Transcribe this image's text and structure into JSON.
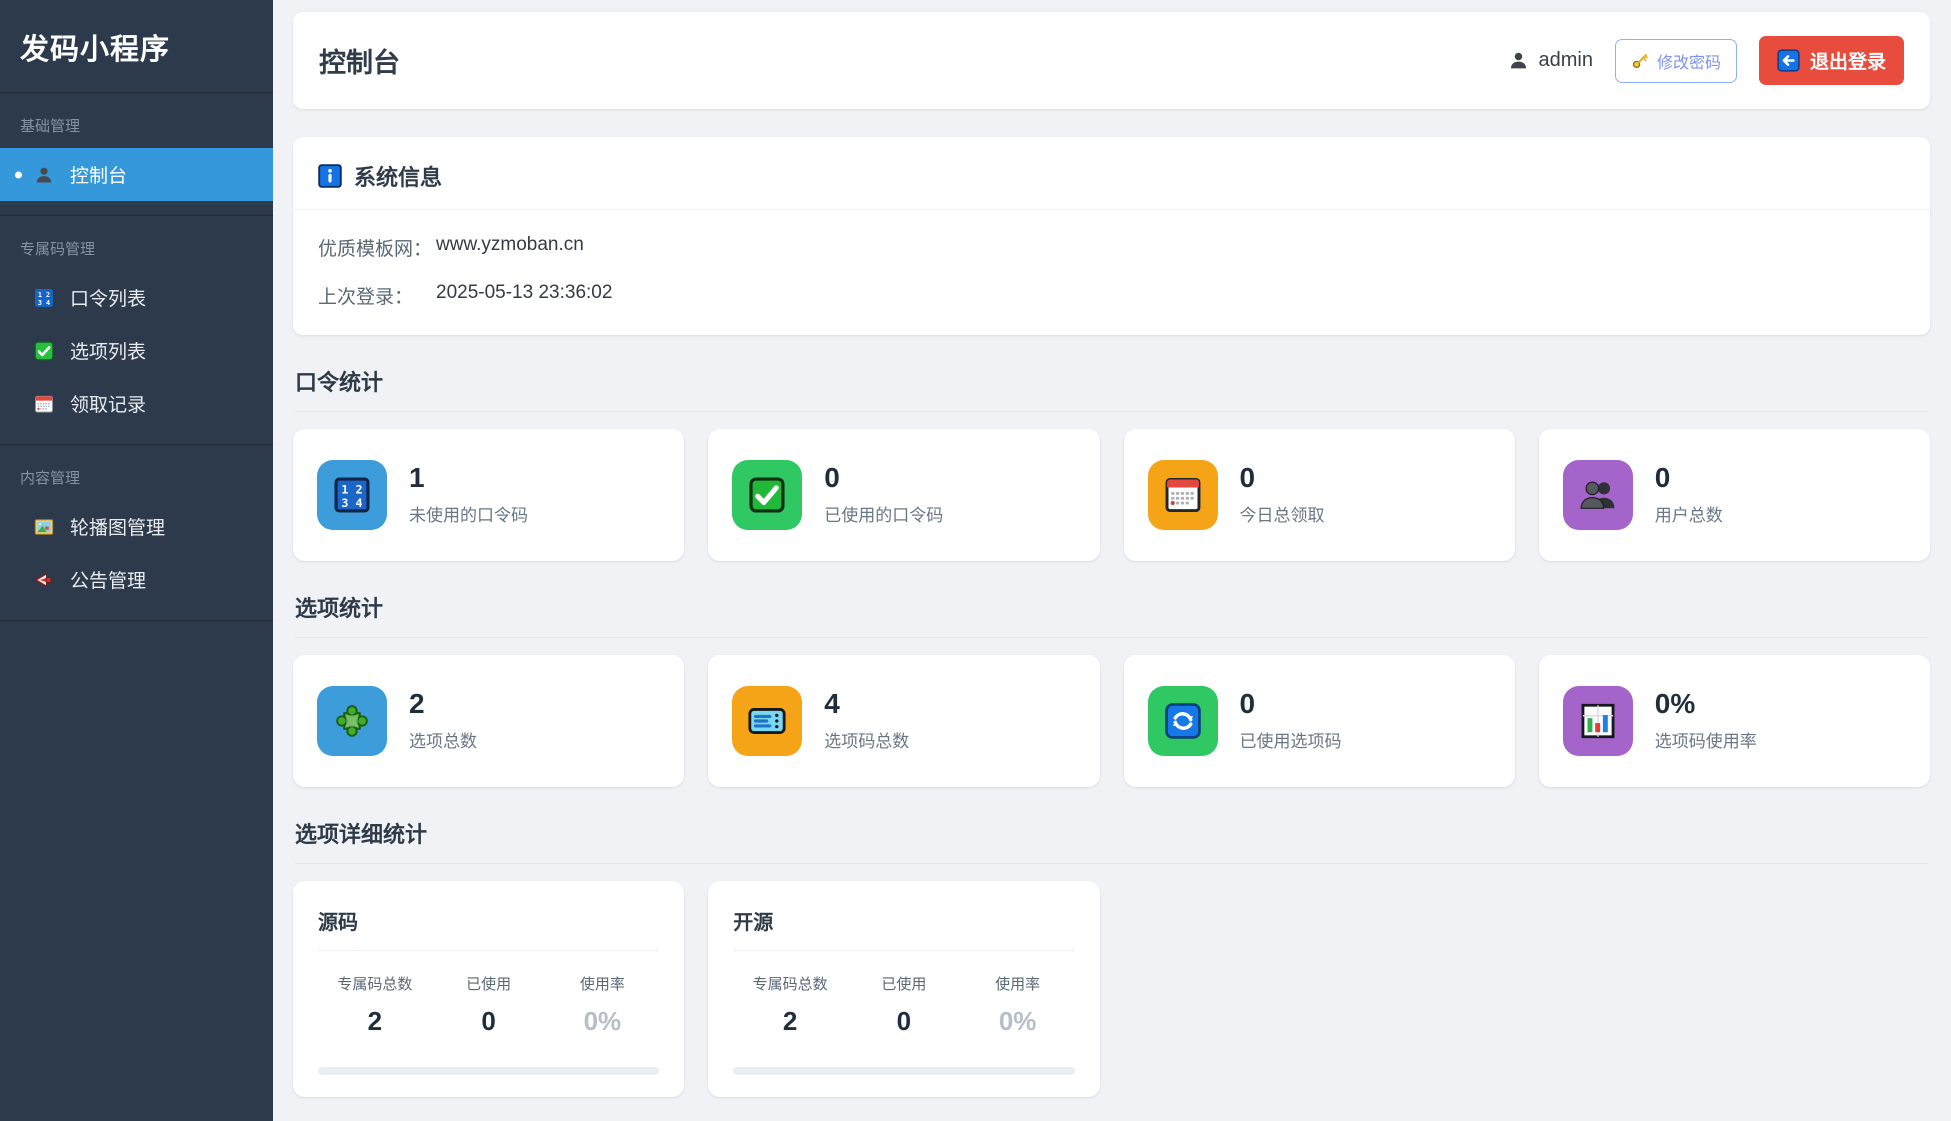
{
  "app": {
    "title": "发码小程序"
  },
  "colors": {
    "sidebar_bg": "#2d3a4b",
    "active_blue": "#3498db",
    "logout_red": "#e84c3d",
    "tile_blue": "#3d9ddb",
    "tile_green": "#2fc862",
    "tile_orange": "#f5a418",
    "tile_purple": "#a564c9"
  },
  "sidebar": {
    "sections": [
      {
        "label": "基础管理",
        "items": [
          {
            "icon": "user-icon",
            "label": "控制台"
          }
        ]
      },
      {
        "label": "专属码管理",
        "items": [
          {
            "icon": "input-numbers-icon",
            "label": "口令列表"
          },
          {
            "icon": "checkbox-icon",
            "label": "选项列表"
          },
          {
            "icon": "calendar-icon",
            "label": "领取记录"
          }
        ]
      },
      {
        "label": "内容管理",
        "items": [
          {
            "icon": "framed-picture-icon",
            "label": "轮播图管理"
          },
          {
            "icon": "megaphone-icon",
            "label": "公告管理"
          }
        ]
      }
    ]
  },
  "header": {
    "title": "控制台",
    "username": "admin",
    "change_password_label": "修改密码",
    "logout_label": "退出登录"
  },
  "system_info": {
    "title": "系统信息",
    "rows": [
      {
        "label": "优质模板网：",
        "value": "www.yzmoban.cn"
      },
      {
        "label": "上次登录：",
        "value": "2025-05-13 23:36:02"
      }
    ]
  },
  "stats_sections": [
    {
      "title": "口令统计",
      "cards": [
        {
          "icon": "input-numbers-icon",
          "tile_color": "#3d9ddb",
          "value": "1",
          "label": "未使用的口令码"
        },
        {
          "icon": "checkbox-icon",
          "tile_color": "#2fc862",
          "value": "0",
          "label": "已使用的口令码"
        },
        {
          "icon": "calendar-icon",
          "tile_color": "#f5a418",
          "value": "0",
          "label": "今日总领取"
        },
        {
          "icon": "users-icon",
          "tile_color": "#a564c9",
          "value": "0",
          "label": "用户总数"
        }
      ]
    },
    {
      "title": "选项统计",
      "cards": [
        {
          "icon": "puzzle-icon",
          "tile_color": "#3d9ddb",
          "value": "2",
          "label": "选项总数"
        },
        {
          "icon": "ticket-icon",
          "tile_color": "#f5a418",
          "value": "4",
          "label": "选项码总数"
        },
        {
          "icon": "refresh-icon",
          "tile_color": "#2fc862",
          "value": "0",
          "label": "已使用选项码"
        },
        {
          "icon": "bar-chart-icon",
          "tile_color": "#a564c9",
          "value": "0%",
          "label": "选项码使用率"
        }
      ]
    }
  ],
  "detail_section": {
    "title": "选项详细统计",
    "cards": [
      {
        "title": "源码",
        "stats": [
          {
            "label": "专属码总数",
            "value": "2"
          },
          {
            "label": "已使用",
            "value": "0"
          },
          {
            "label": "使用率",
            "value": "0%"
          }
        ],
        "progress_percent": 0
      },
      {
        "title": "开源",
        "stats": [
          {
            "label": "专属码总数",
            "value": "2"
          },
          {
            "label": "已使用",
            "value": "0"
          },
          {
            "label": "使用率",
            "value": "0%"
          }
        ],
        "progress_percent": 0
      }
    ]
  }
}
